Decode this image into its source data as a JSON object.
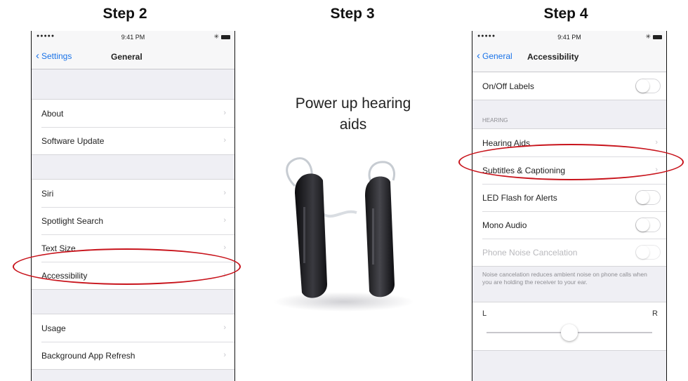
{
  "steps": {
    "step2": "Step 2",
    "step3": "Step 3",
    "step4": "Step 4"
  },
  "status": {
    "signal": "●●●●●",
    "wifi": "≈",
    "time": "9:41 PM",
    "bluetooth": "✳"
  },
  "phone_general": {
    "back_label": "Settings",
    "title": "General",
    "group1": [
      {
        "label": "About"
      },
      {
        "label": "Software Update"
      }
    ],
    "group2": [
      {
        "label": "Siri"
      },
      {
        "label": "Spotlight Search"
      },
      {
        "label": "Text Size"
      },
      {
        "label": "Accessibility"
      }
    ],
    "group3": [
      {
        "label": "Usage"
      },
      {
        "label": "Background App Refresh"
      }
    ]
  },
  "step3": {
    "caption_line1": "Power up hearing",
    "caption_line2": "aids"
  },
  "phone_accessibility": {
    "back_label": "General",
    "title": "Accessibility",
    "row_onoff": "On/Off Labels",
    "section_hearing": "HEARING",
    "rows": [
      {
        "label": "Hearing Aids"
      },
      {
        "label": "Subtitles & Captioning"
      },
      {
        "label": "LED Flash for Alerts"
      },
      {
        "label": "Mono Audio"
      },
      {
        "label": "Phone Noise Cancelation"
      }
    ],
    "footnote": "Noise cancelation reduces ambient noise on phone calls when you are holding the receiver to your ear.",
    "balance_left": "L",
    "balance_right": "R",
    "balance_value": 0.5
  },
  "colors": {
    "ios_blue": "#1a73e8",
    "highlight_red": "#c8141c"
  }
}
